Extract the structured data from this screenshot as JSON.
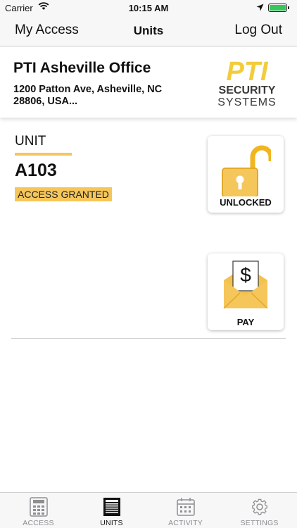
{
  "status_bar": {
    "carrier": "Carrier",
    "time": "10:15 AM",
    "battery_level": 1.0
  },
  "nav": {
    "left": "My Access",
    "title": "Units",
    "right": "Log Out"
  },
  "facility": {
    "name": "PTI Asheville Office",
    "address": "1200 Patton Ave, Asheville, NC 28806, USA...",
    "logo": {
      "mark": "PTI",
      "line1": "SECURITY",
      "line2": "SYSTEMS"
    }
  },
  "unit": {
    "label": "UNIT",
    "id": "A103",
    "status": "ACCESS GRANTED"
  },
  "actions": {
    "unlock_label": "UNLOCKED",
    "pay_label": "PAY",
    "pay_symbol": "$"
  },
  "tabs": [
    {
      "label": "ACCESS",
      "icon": "keypad-icon",
      "active": false
    },
    {
      "label": "UNITS",
      "icon": "building-icon",
      "active": true
    },
    {
      "label": "ACTIVITY",
      "icon": "calendar-icon",
      "active": false
    },
    {
      "label": "SETTINGS",
      "icon": "gear-icon",
      "active": false
    }
  ],
  "colors": {
    "accent": "#f5c65a",
    "logo_yellow": "#f3cc3b",
    "logo_dark": "#3a3a3a",
    "inactive_tab": "#8e8e93"
  }
}
